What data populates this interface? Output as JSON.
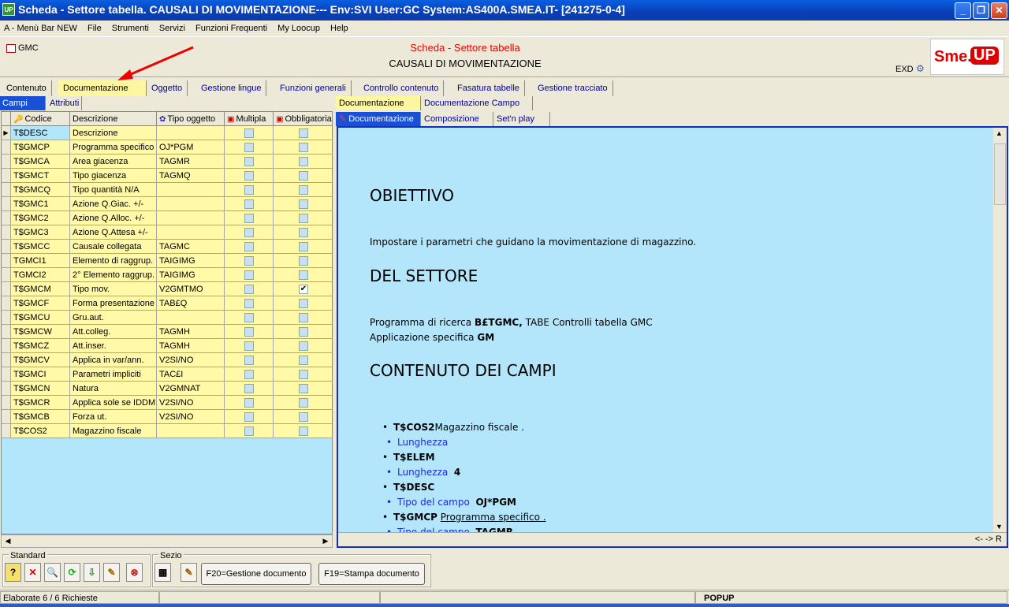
{
  "window": {
    "icon_text": "UP",
    "title": "Scheda - Settore tabella. CAUSALI DI MOVIMENTAZIONE--- Env:SVI User:GC System:AS400A.SMEA.IT- [241275-0-4]",
    "minimize": "_",
    "restore": "❐",
    "close": "✕"
  },
  "menu": [
    "A - Menù Bar NEW",
    "File",
    "Strumenti",
    "Servizi",
    "Funzioni Frequenti",
    "My Loocup",
    "Help"
  ],
  "header": {
    "code": "GMC",
    "title": "Scheda - Settore tabella",
    "subtitle": "CAUSALI DI MOVIMENTAZIONE",
    "env": "EXD",
    "logo_left": "Sme.",
    "logo_right": "UP"
  },
  "main_tabs": [
    "Contenuto",
    "Documentazione",
    "Oggetto",
    "Gestione lingue",
    "Funzioni generali",
    "Controllo contenuto",
    "Fasatura tabelle",
    "Gestione tracciato"
  ],
  "left_tabs": [
    "Campi",
    "Attributi"
  ],
  "grid": {
    "columns": [
      "Codice",
      "Descrizione",
      "Tipo oggetto",
      "Multipla",
      "Obbligatoria"
    ],
    "rows": [
      {
        "code": "T$DESC",
        "desc": "Descrizione",
        "type": "",
        "mult": false,
        "obb": false
      },
      {
        "code": "T$GMCP",
        "desc": "Programma specifico",
        "type": "OJ*PGM",
        "mult": false,
        "obb": false
      },
      {
        "code": "T$GMCA",
        "desc": "Area giacenza",
        "type": "TAGMR",
        "mult": false,
        "obb": false
      },
      {
        "code": "T$GMCT",
        "desc": "Tipo giacenza",
        "type": "TAGMQ",
        "mult": false,
        "obb": false
      },
      {
        "code": "T$GMCQ",
        "desc": "Tipo quantità    N/A",
        "type": "",
        "mult": false,
        "obb": false
      },
      {
        "code": "T$GMC1",
        "desc": "Azione Q.Giac.    +/-",
        "type": "",
        "mult": false,
        "obb": false
      },
      {
        "code": "T$GMC2",
        "desc": "Azione Q.Alloc.   +/-",
        "type": "",
        "mult": false,
        "obb": false
      },
      {
        "code": "T$GMC3",
        "desc": "Azione Q.Attesa  +/-",
        "type": "",
        "mult": false,
        "obb": false
      },
      {
        "code": "T$GMCC",
        "desc": "Causale collegata",
        "type": "TAGMC",
        "mult": false,
        "obb": false
      },
      {
        "code": "TGMCI1",
        "desc": "Elemento di raggrup.",
        "type": "TAIGIMG",
        "mult": false,
        "obb": false
      },
      {
        "code": "TGMCI2",
        "desc": "2° Elemento raggrup.",
        "type": "TAIGIMG",
        "mult": false,
        "obb": false
      },
      {
        "code": "T$GMCM",
        "desc": "Tipo mov.",
        "type": "V2GMTMO",
        "mult": false,
        "obb": true
      },
      {
        "code": "T$GMCF",
        "desc": "Forma presentazione",
        "type": "TAB£Q",
        "mult": false,
        "obb": false
      },
      {
        "code": "T$GMCU",
        "desc": "Gru.aut.",
        "type": "",
        "mult": false,
        "obb": false
      },
      {
        "code": "T$GMCW",
        "desc": "Att.colleg.",
        "type": "TAGMH",
        "mult": false,
        "obb": false
      },
      {
        "code": "T$GMCZ",
        "desc": "Att.inser.",
        "type": "TAGMH",
        "mult": false,
        "obb": false
      },
      {
        "code": "T$GMCV",
        "desc": "Applica in var/ann.",
        "type": "V2SI/NO",
        "mult": false,
        "obb": false
      },
      {
        "code": "T$GMCI",
        "desc": "Parametri impliciti",
        "type": "TAC£I",
        "mult": false,
        "obb": false
      },
      {
        "code": "T$GMCN",
        "desc": "Natura",
        "type": "V2GMNAT",
        "mult": false,
        "obb": false
      },
      {
        "code": "T$GMCR",
        "desc": "Applica sole se IDDM",
        "type": "V2SI/NO",
        "mult": false,
        "obb": false
      },
      {
        "code": "T$GMCB",
        "desc": "Forza ut.",
        "type": "V2SI/NO",
        "mult": false,
        "obb": false
      },
      {
        "code": "T$COS2",
        "desc": "Magazzino fiscale",
        "type": "",
        "mult": false,
        "obb": false
      }
    ]
  },
  "right_tabs_row1": [
    "Documentazione",
    "Documentazione Campo"
  ],
  "right_tabs_row2": [
    "Documentazione",
    "Composizione",
    "Set'n play"
  ],
  "doc": {
    "h1": "OBIETTIVO",
    "p1": "Impostare i parametri che guidano la movimentazione di magazzino.",
    "h2": "DEL SETTORE",
    "p2a_pre": "Programma di ricerca ",
    "p2a_bold": "B£TGMC,",
    "p2a_post": " TABE Controlli tabella GMC",
    "p2b_pre": "Applicazione specifica ",
    "p2b_bold": "GM",
    "h3": "CONTENUTO DEI CAMPI",
    "items": [
      {
        "code": "T$COS2",
        "text": "Magazzino fiscale .",
        "sub_label": "Lunghezza",
        "sub_value": ""
      },
      {
        "code": "T$ELEM",
        "text": "",
        "sub_label": "Lunghezza",
        "sub_value": "4"
      },
      {
        "code": "T$DESC",
        "text": "",
        "sub_label": "Tipo del campo",
        "sub_value": "OJ*PGM"
      },
      {
        "code": "T$GMCP",
        "text": "Programma specifico .",
        "sub_label": "Tipo del campo",
        "sub_value": "TAGMR"
      }
    ],
    "footer": "<- ->  R"
  },
  "toolbar": {
    "group1": "Standard",
    "group2": "Sezio",
    "btn_icons": [
      "?",
      "✕",
      "🔍",
      "⟳",
      "⇩",
      "✎",
      "⊗"
    ],
    "f20": "F20=Gestione documento",
    "f19": "F19=Stampa documento"
  },
  "status": {
    "left": "Elaborate 6 / 6 Richieste",
    "popup": "POPUP"
  }
}
